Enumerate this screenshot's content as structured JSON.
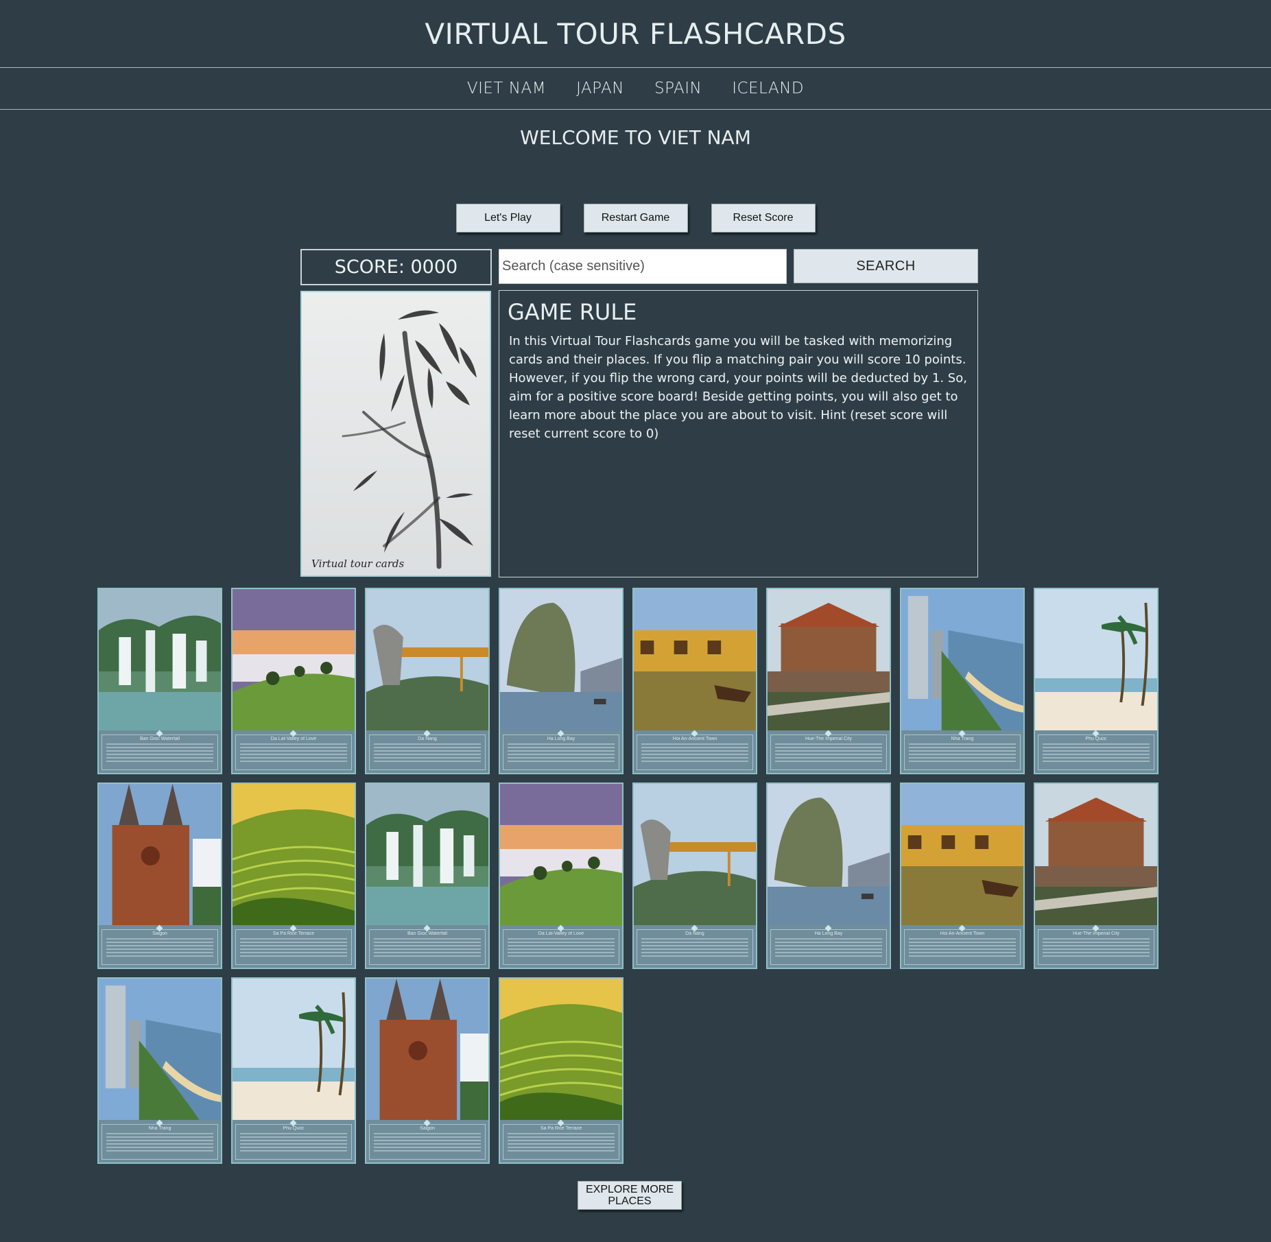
{
  "header": {
    "title": "VIRTUAL TOUR FLASHCARDS"
  },
  "nav": {
    "items": [
      "VIET NAM",
      "JAPAN",
      "SPAIN",
      "ICELAND"
    ]
  },
  "welcome": "WELCOME TO VIET NAM",
  "controls": {
    "lets_play": "Let's Play",
    "restart": "Restart Game",
    "reset_score": "Reset Score"
  },
  "score": {
    "label": "SCORE: 0000"
  },
  "search": {
    "placeholder": "Search (case sensitive)",
    "button": "SEARCH"
  },
  "intro_card": {
    "signature": "Virtual tour cards"
  },
  "rules": {
    "title": "GAME RULE",
    "text": "In this Virtual Tour Flashcards game you will be tasked with memorizing cards and their places. If you flip a matching pair you will score 10 points. However, if you flip the wrong card, your points will be deducted by 1. So, aim for a positive score board! Beside getting points, you will also get to learn more about the place you are about to visit. Hint (reset score will reset current score to 0)"
  },
  "cards": [
    {
      "scene": "waterfall",
      "title": "Ban Gioc Waterfall"
    },
    {
      "scene": "valley",
      "title": "Da Lat-Valley of Love"
    },
    {
      "scene": "bridge",
      "title": "Da Nang"
    },
    {
      "scene": "bay",
      "title": "Ha Long Bay"
    },
    {
      "scene": "town",
      "title": "Hoi An-Ancient Town"
    },
    {
      "scene": "citadel",
      "title": "Hue-The Imperial City"
    },
    {
      "scene": "beach-city",
      "title": "Nha Trang"
    },
    {
      "scene": "palms",
      "title": "Phu Quoc"
    },
    {
      "scene": "cathedral",
      "title": "Saigon"
    },
    {
      "scene": "terrace",
      "title": "Sa Pa Rice Terrace"
    },
    {
      "scene": "waterfall",
      "title": "Ban Gioc Waterfall"
    },
    {
      "scene": "valley",
      "title": "Da Lat-Valley of Love"
    },
    {
      "scene": "bridge",
      "title": "Da Nang"
    },
    {
      "scene": "bay",
      "title": "Ha Long Bay"
    },
    {
      "scene": "town",
      "title": "Hoi An-Ancient Town"
    },
    {
      "scene": "citadel",
      "title": "Hue-The Imperial City"
    },
    {
      "scene": "beach-city",
      "title": "Nha Trang"
    },
    {
      "scene": "palms",
      "title": "Phu Quoc"
    },
    {
      "scene": "cathedral",
      "title": "Saigon"
    },
    {
      "scene": "terrace",
      "title": "Sa Pa Rice Terrace"
    }
  ],
  "explore_button": "EXPLORE MORE PLACES"
}
